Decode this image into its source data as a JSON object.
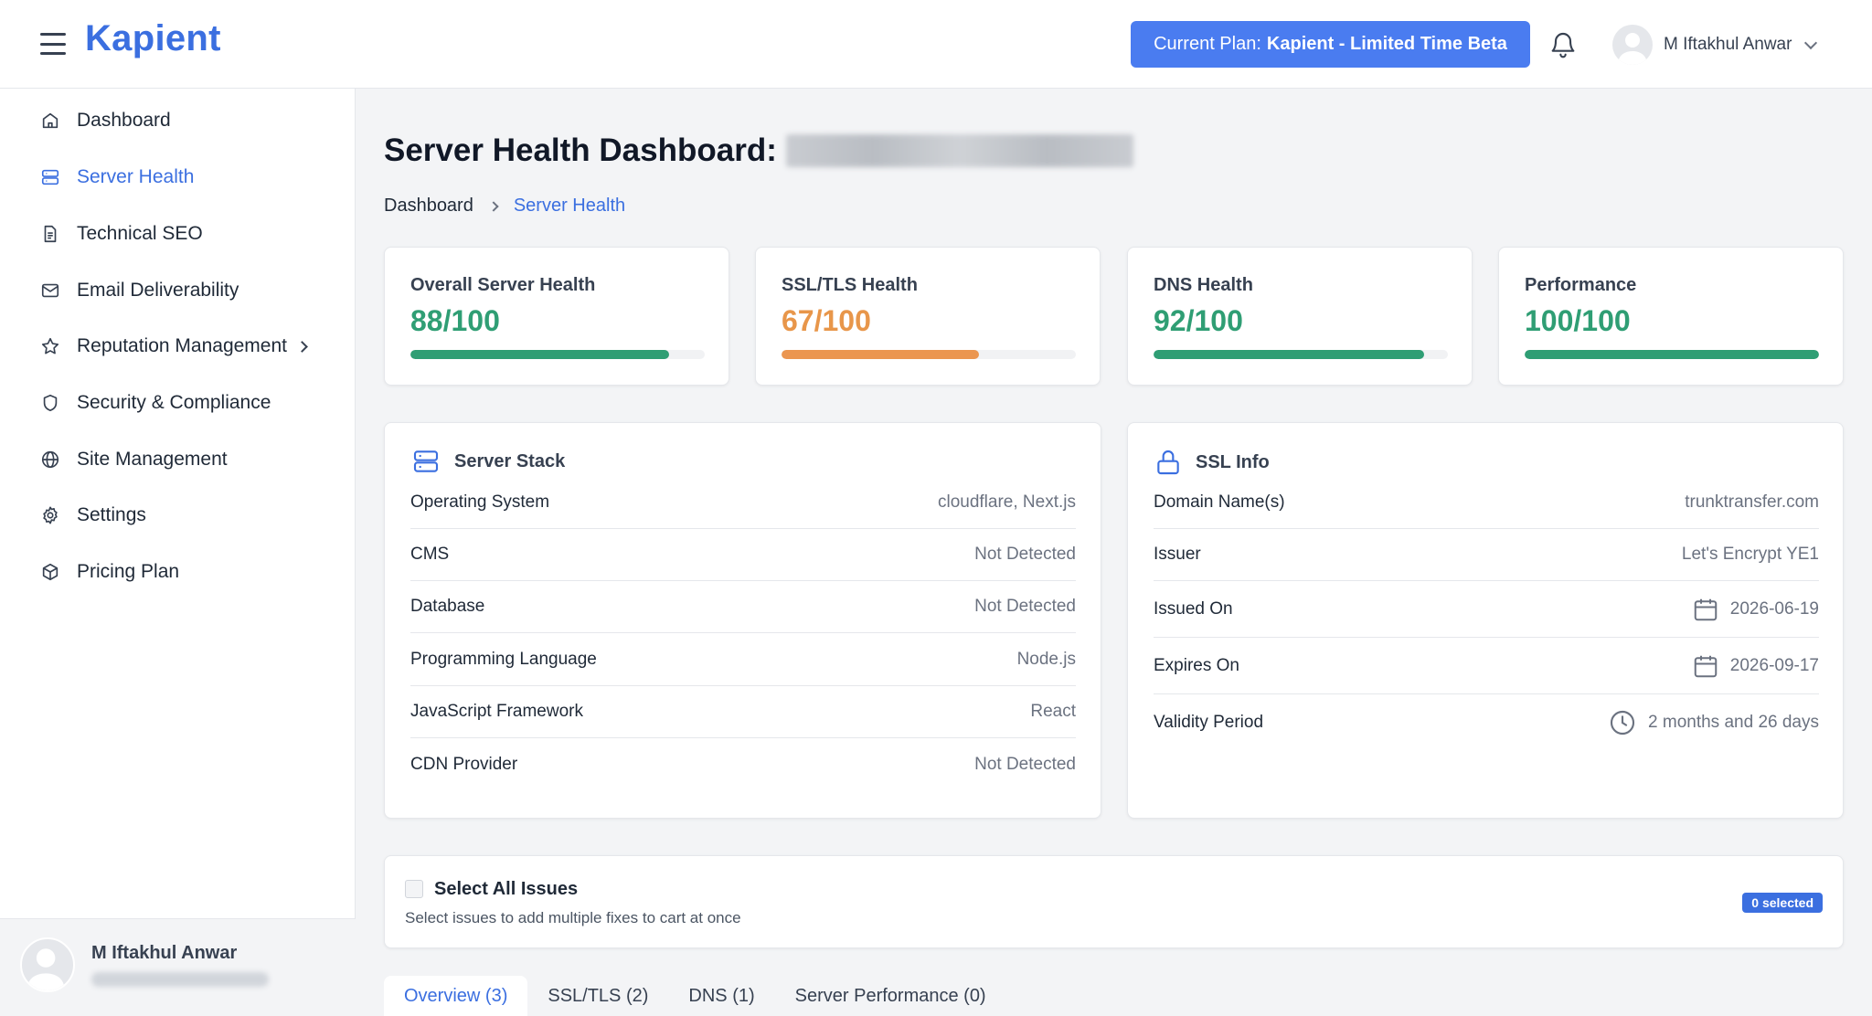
{
  "header": {
    "logo": "Kapient",
    "plan_prefix": "Current Plan:",
    "plan_name": "Kapient - Limited Time Beta",
    "user_name": "M Iftakhul Anwar"
  },
  "sidebar": {
    "items": [
      {
        "label": "Dashboard",
        "icon": "home-icon"
      },
      {
        "label": "Server Health",
        "icon": "server-icon"
      },
      {
        "label": "Technical SEO",
        "icon": "document-icon"
      },
      {
        "label": "Email Deliverability",
        "icon": "mail-icon"
      },
      {
        "label": "Reputation Management",
        "icon": "star-icon"
      },
      {
        "label": "Security & Compliance",
        "icon": "shield-icon"
      },
      {
        "label": "Site Management",
        "icon": "globe-icon"
      },
      {
        "label": "Settings",
        "icon": "gear-icon"
      },
      {
        "label": "Pricing Plan",
        "icon": "cube-icon"
      }
    ],
    "active_index": 1,
    "footer_name": "M Iftakhul Anwar"
  },
  "page": {
    "title": "Server Health Dashboard:"
  },
  "breadcrumb": {
    "home": "Dashboard",
    "current": "Server Health"
  },
  "scores": [
    {
      "label": "Overall Server Health",
      "value": "88/100",
      "fraction": 0.88,
      "color": "#2f9e74",
      "bar_color": "#2f9e74"
    },
    {
      "label": "SSL/TLS Health",
      "value": "67/100",
      "fraction": 0.67,
      "color": "#e8964a",
      "bar_color": "#eb9650"
    },
    {
      "label": "DNS Health",
      "value": "92/100",
      "fraction": 0.92,
      "color": "#2f9e74",
      "bar_color": "#2f9e74"
    },
    {
      "label": "Performance",
      "value": "100/100",
      "fraction": 1.0,
      "color": "#2f9e74",
      "bar_color": "#2f9e74"
    }
  ],
  "server_stack": {
    "title": "Server Stack",
    "rows": [
      {
        "key": "Operating System",
        "value": "cloudflare, Next.js"
      },
      {
        "key": "CMS",
        "value": "Not Detected"
      },
      {
        "key": "Database",
        "value": "Not Detected"
      },
      {
        "key": "Programming Language",
        "value": "Node.js"
      },
      {
        "key": "JavaScript Framework",
        "value": "React"
      },
      {
        "key": "CDN Provider",
        "value": "Not Detected"
      }
    ]
  },
  "ssl_info": {
    "title": "SSL Info",
    "rows": [
      {
        "key": "Domain Name(s)",
        "value": "trunktransfer.com"
      },
      {
        "key": "Issuer",
        "value": "Let's Encrypt YE1"
      },
      {
        "key": "Issued On",
        "value": "2026-06-19"
      },
      {
        "key": "Expires On",
        "value": "2026-09-17"
      },
      {
        "key": "Validity Period",
        "value": "2 months and 26 days"
      }
    ]
  },
  "issues": {
    "title": "Select All Issues",
    "description": "Select issues to add multiple fixes to cart at once",
    "badge": "0 selected"
  },
  "tabs": [
    {
      "label": "Overview (3)"
    },
    {
      "label": "SSL/TLS (2)"
    },
    {
      "label": "DNS (1)"
    },
    {
      "label": "Server Performance (0)"
    }
  ]
}
